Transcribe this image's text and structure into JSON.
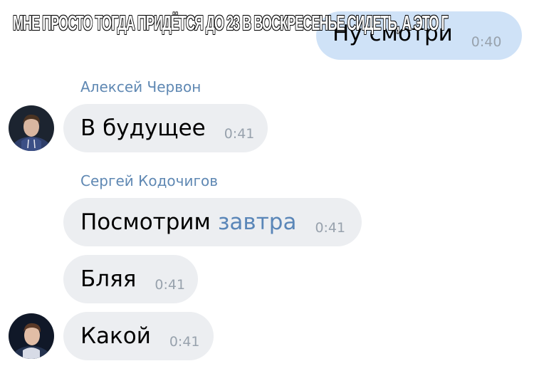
{
  "caption": "МНЕ ПРОСТО ТОГДА ПРИДЁТСЯ ДО 23 В ВОСКРЕСЕНЬЕ СИДЕТЬ, А ЭТО Г",
  "messages": [
    {
      "text": "Ну смотри",
      "time": "0:40",
      "direction": "outgoing"
    },
    {
      "sender": "Алексей Червон",
      "text": "В будущее",
      "time": "0:41",
      "direction": "incoming"
    },
    {
      "sender": "Сергей Кодочигов",
      "text": "Посмотрим",
      "link": "завтра",
      "time": "0:41",
      "direction": "incoming"
    },
    {
      "text": "Бляя",
      "time": "0:41",
      "direction": "incoming"
    },
    {
      "text": "Какой",
      "time": "0:41",
      "direction": "incoming"
    }
  ],
  "colors": {
    "outgoing_bubble": "#cfe2f7",
    "incoming_bubble": "#eceef1",
    "sender_name": "#5f88b3",
    "link": "#5a86b8",
    "time": "#98a2ad"
  },
  "icons": {
    "avatar_1": "user-avatar",
    "avatar_2": "user-avatar"
  }
}
